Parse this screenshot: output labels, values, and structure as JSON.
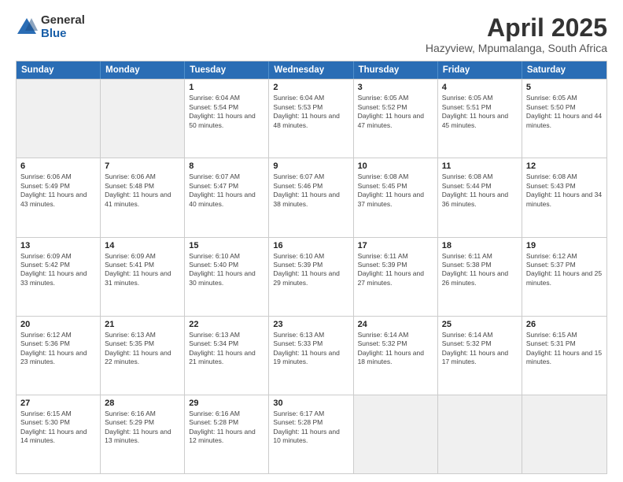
{
  "logo": {
    "general": "General",
    "blue": "Blue"
  },
  "title": "April 2025",
  "subtitle": "Hazyview, Mpumalanga, South Africa",
  "header_days": [
    "Sunday",
    "Monday",
    "Tuesday",
    "Wednesday",
    "Thursday",
    "Friday",
    "Saturday"
  ],
  "weeks": [
    [
      {
        "day": "",
        "sunrise": "",
        "sunset": "",
        "daylight": "",
        "empty": true
      },
      {
        "day": "",
        "sunrise": "",
        "sunset": "",
        "daylight": "",
        "empty": true
      },
      {
        "day": "1",
        "sunrise": "Sunrise: 6:04 AM",
        "sunset": "Sunset: 5:54 PM",
        "daylight": "Daylight: 11 hours and 50 minutes."
      },
      {
        "day": "2",
        "sunrise": "Sunrise: 6:04 AM",
        "sunset": "Sunset: 5:53 PM",
        "daylight": "Daylight: 11 hours and 48 minutes."
      },
      {
        "day": "3",
        "sunrise": "Sunrise: 6:05 AM",
        "sunset": "Sunset: 5:52 PM",
        "daylight": "Daylight: 11 hours and 47 minutes."
      },
      {
        "day": "4",
        "sunrise": "Sunrise: 6:05 AM",
        "sunset": "Sunset: 5:51 PM",
        "daylight": "Daylight: 11 hours and 45 minutes."
      },
      {
        "day": "5",
        "sunrise": "Sunrise: 6:05 AM",
        "sunset": "Sunset: 5:50 PM",
        "daylight": "Daylight: 11 hours and 44 minutes."
      }
    ],
    [
      {
        "day": "6",
        "sunrise": "Sunrise: 6:06 AM",
        "sunset": "Sunset: 5:49 PM",
        "daylight": "Daylight: 11 hours and 43 minutes."
      },
      {
        "day": "7",
        "sunrise": "Sunrise: 6:06 AM",
        "sunset": "Sunset: 5:48 PM",
        "daylight": "Daylight: 11 hours and 41 minutes."
      },
      {
        "day": "8",
        "sunrise": "Sunrise: 6:07 AM",
        "sunset": "Sunset: 5:47 PM",
        "daylight": "Daylight: 11 hours and 40 minutes."
      },
      {
        "day": "9",
        "sunrise": "Sunrise: 6:07 AM",
        "sunset": "Sunset: 5:46 PM",
        "daylight": "Daylight: 11 hours and 38 minutes."
      },
      {
        "day": "10",
        "sunrise": "Sunrise: 6:08 AM",
        "sunset": "Sunset: 5:45 PM",
        "daylight": "Daylight: 11 hours and 37 minutes."
      },
      {
        "day": "11",
        "sunrise": "Sunrise: 6:08 AM",
        "sunset": "Sunset: 5:44 PM",
        "daylight": "Daylight: 11 hours and 36 minutes."
      },
      {
        "day": "12",
        "sunrise": "Sunrise: 6:08 AM",
        "sunset": "Sunset: 5:43 PM",
        "daylight": "Daylight: 11 hours and 34 minutes."
      }
    ],
    [
      {
        "day": "13",
        "sunrise": "Sunrise: 6:09 AM",
        "sunset": "Sunset: 5:42 PM",
        "daylight": "Daylight: 11 hours and 33 minutes."
      },
      {
        "day": "14",
        "sunrise": "Sunrise: 6:09 AM",
        "sunset": "Sunset: 5:41 PM",
        "daylight": "Daylight: 11 hours and 31 minutes."
      },
      {
        "day": "15",
        "sunrise": "Sunrise: 6:10 AM",
        "sunset": "Sunset: 5:40 PM",
        "daylight": "Daylight: 11 hours and 30 minutes."
      },
      {
        "day": "16",
        "sunrise": "Sunrise: 6:10 AM",
        "sunset": "Sunset: 5:39 PM",
        "daylight": "Daylight: 11 hours and 29 minutes."
      },
      {
        "day": "17",
        "sunrise": "Sunrise: 6:11 AM",
        "sunset": "Sunset: 5:39 PM",
        "daylight": "Daylight: 11 hours and 27 minutes."
      },
      {
        "day": "18",
        "sunrise": "Sunrise: 6:11 AM",
        "sunset": "Sunset: 5:38 PM",
        "daylight": "Daylight: 11 hours and 26 minutes."
      },
      {
        "day": "19",
        "sunrise": "Sunrise: 6:12 AM",
        "sunset": "Sunset: 5:37 PM",
        "daylight": "Daylight: 11 hours and 25 minutes."
      }
    ],
    [
      {
        "day": "20",
        "sunrise": "Sunrise: 6:12 AM",
        "sunset": "Sunset: 5:36 PM",
        "daylight": "Daylight: 11 hours and 23 minutes."
      },
      {
        "day": "21",
        "sunrise": "Sunrise: 6:13 AM",
        "sunset": "Sunset: 5:35 PM",
        "daylight": "Daylight: 11 hours and 22 minutes."
      },
      {
        "day": "22",
        "sunrise": "Sunrise: 6:13 AM",
        "sunset": "Sunset: 5:34 PM",
        "daylight": "Daylight: 11 hours and 21 minutes."
      },
      {
        "day": "23",
        "sunrise": "Sunrise: 6:13 AM",
        "sunset": "Sunset: 5:33 PM",
        "daylight": "Daylight: 11 hours and 19 minutes."
      },
      {
        "day": "24",
        "sunrise": "Sunrise: 6:14 AM",
        "sunset": "Sunset: 5:32 PM",
        "daylight": "Daylight: 11 hours and 18 minutes."
      },
      {
        "day": "25",
        "sunrise": "Sunrise: 6:14 AM",
        "sunset": "Sunset: 5:32 PM",
        "daylight": "Daylight: 11 hours and 17 minutes."
      },
      {
        "day": "26",
        "sunrise": "Sunrise: 6:15 AM",
        "sunset": "Sunset: 5:31 PM",
        "daylight": "Daylight: 11 hours and 15 minutes."
      }
    ],
    [
      {
        "day": "27",
        "sunrise": "Sunrise: 6:15 AM",
        "sunset": "Sunset: 5:30 PM",
        "daylight": "Daylight: 11 hours and 14 minutes."
      },
      {
        "day": "28",
        "sunrise": "Sunrise: 6:16 AM",
        "sunset": "Sunset: 5:29 PM",
        "daylight": "Daylight: 11 hours and 13 minutes."
      },
      {
        "day": "29",
        "sunrise": "Sunrise: 6:16 AM",
        "sunset": "Sunset: 5:28 PM",
        "daylight": "Daylight: 11 hours and 12 minutes."
      },
      {
        "day": "30",
        "sunrise": "Sunrise: 6:17 AM",
        "sunset": "Sunset: 5:28 PM",
        "daylight": "Daylight: 11 hours and 10 minutes."
      },
      {
        "day": "",
        "sunrise": "",
        "sunset": "",
        "daylight": "",
        "empty": true
      },
      {
        "day": "",
        "sunrise": "",
        "sunset": "",
        "daylight": "",
        "empty": true
      },
      {
        "day": "",
        "sunrise": "",
        "sunset": "",
        "daylight": "",
        "empty": true
      }
    ]
  ]
}
